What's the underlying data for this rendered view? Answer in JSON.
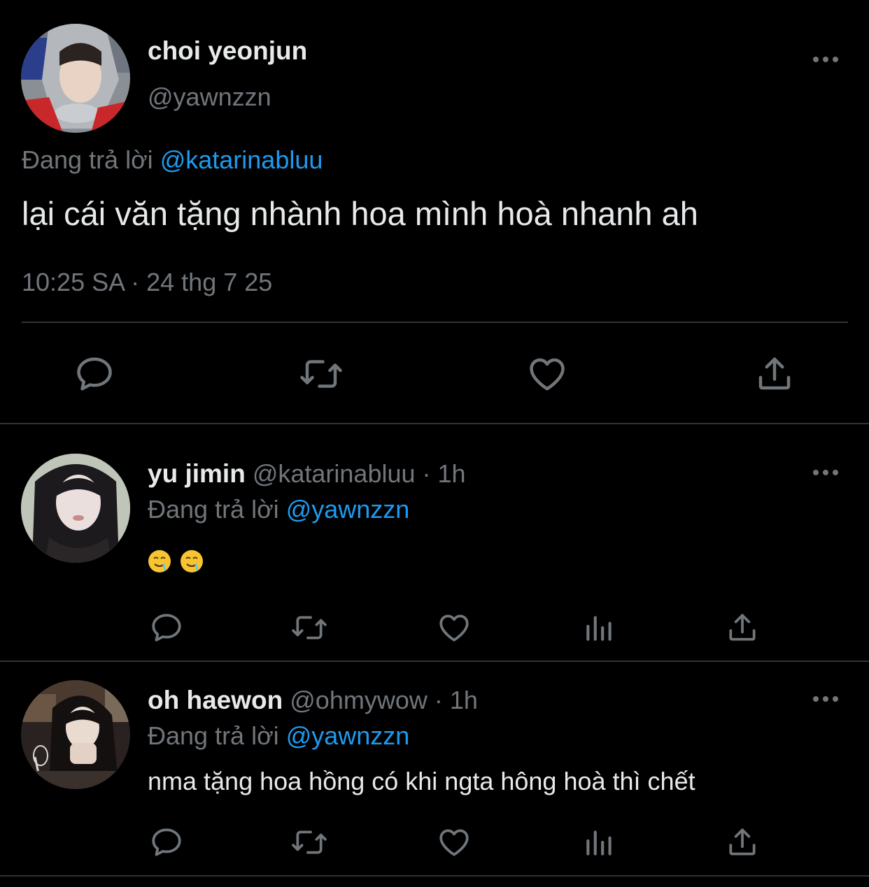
{
  "main_tweet": {
    "display_name": "choi yeonjun",
    "handle": "@yawnzzn",
    "reply_label": "Đang trả lời",
    "reply_to": "@katarinabluu",
    "text": "lại cái văn tặng nhành hoa mình hoà nhanh ah",
    "timestamp": "10:25 SA · 24 thg 7 25"
  },
  "replies": [
    {
      "display_name": "yu jimin",
      "handle": "@katarinabluu",
      "time": "· 1h",
      "reply_label": "Đang trả lời",
      "reply_to": "@yawnzzn",
      "emoji": [
        "drooling-face",
        "drooling-face"
      ]
    },
    {
      "display_name": "oh haewon",
      "handle": "@ohmywow",
      "time": "· 1h",
      "reply_label": "Đang trả lời",
      "reply_to": "@yawnzzn",
      "text": "nma tặng hoa hồng có khi ngta hông hoà thì chết"
    }
  ],
  "colors": {
    "background": "#000000",
    "primary_text": "#e7e9ea",
    "secondary_text": "#71767b",
    "link": "#1d9bf0",
    "divider": "#2f3336"
  },
  "icons": [
    "more-icon",
    "reply-icon",
    "retweet-icon",
    "like-icon",
    "views-icon",
    "share-icon"
  ]
}
